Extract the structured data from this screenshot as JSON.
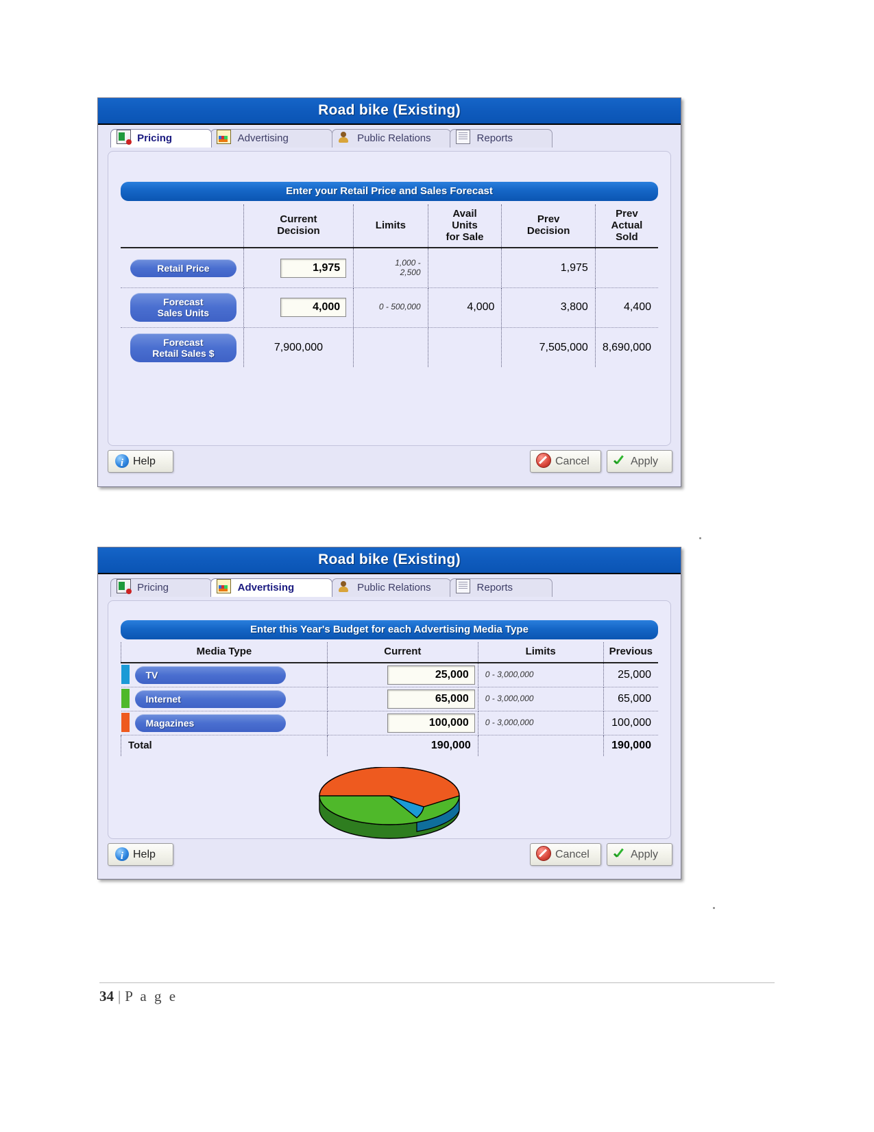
{
  "document": {
    "page_label": "34",
    "page_word": "P a g e",
    "separator": "|"
  },
  "colors": {
    "title_blue": "#0f5bbd",
    "banner_blue": "#1566c6",
    "pill_blue": "#4a6fd0",
    "tv": "#1b9ad6",
    "internet": "#4fb82a",
    "magazines": "#ee5a1f",
    "panel_bg": "#eaeafa"
  },
  "dialogs": [
    {
      "id": "pricing-dialog",
      "title": "Road bike (Existing)",
      "tabs": [
        {
          "label": "Pricing",
          "icon": "pricing-document-icon",
          "active": true
        },
        {
          "label": "Advertising",
          "icon": "advertising-chart-icon",
          "active": false
        },
        {
          "label": "Public Relations",
          "icon": "public-relations-person-icon",
          "active": false
        },
        {
          "label": "Reports",
          "icon": "reports-page-icon",
          "active": false
        }
      ],
      "section_title": "Enter your Retail Price and Sales Forecast",
      "columns": [
        "",
        "Current Decision",
        "Limits",
        "Avail Units for Sale",
        "Prev Decision",
        "Prev Actual Sold"
      ],
      "rows": [
        {
          "label": "Retail Price",
          "current": "1,975",
          "editable": true,
          "limits": "1,000 - 2,500",
          "avail": "",
          "prev_decision": "1,975",
          "prev_actual": ""
        },
        {
          "label": "Forecast Sales Units",
          "current": "4,000",
          "editable": true,
          "limits": "0 - 500,000",
          "avail": "4,000",
          "prev_decision": "3,800",
          "prev_actual": "4,400"
        },
        {
          "label": "Forecast Retail Sales $",
          "current": "7,900,000",
          "editable": false,
          "limits": "",
          "avail": "",
          "prev_decision": "7,505,000",
          "prev_actual": "8,690,000"
        }
      ],
      "buttons": {
        "help": "Help",
        "cancel": "Cancel",
        "apply": "Apply"
      }
    },
    {
      "id": "advertising-dialog",
      "title": "Road bike (Existing)",
      "tabs": [
        {
          "label": "Pricing",
          "icon": "pricing-document-icon",
          "active": false
        },
        {
          "label": "Advertising",
          "icon": "advertising-chart-icon",
          "active": true
        },
        {
          "label": "Public Relations",
          "icon": "public-relations-person-icon",
          "active": false
        },
        {
          "label": "Reports",
          "icon": "reports-page-icon",
          "active": false
        }
      ],
      "section_title": "Enter this Year's Budget for each Advertising Media Type",
      "columns": [
        "Media Type",
        "Current",
        "Limits",
        "Previous"
      ],
      "rows": [
        {
          "label": "TV",
          "swatch": "#1b9ad6",
          "current": "25,000",
          "limits": "0 - 3,000,000",
          "previous": "25,000"
        },
        {
          "label": "Internet",
          "swatch": "#4fb82a",
          "current": "65,000",
          "limits": "0 - 3,000,000",
          "previous": "65,000"
        },
        {
          "label": "Magazines",
          "swatch": "#ee5a1f",
          "current": "100,000",
          "limits": "0 - 3,000,000",
          "previous": "100,000"
        }
      ],
      "total": {
        "label": "Total",
        "current": "190,000",
        "limits": "",
        "previous": "190,000"
      },
      "buttons": {
        "help": "Help",
        "cancel": "Cancel",
        "apply": "Apply"
      }
    }
  ],
  "chart_data": {
    "type": "pie",
    "title": "",
    "labels": [
      "TV",
      "Internet",
      "Magazines"
    ],
    "values": [
      25000,
      65000,
      100000
    ],
    "percentages": [
      13.2,
      34.2,
      52.6
    ],
    "colors": [
      "#1b9ad6",
      "#4fb82a",
      "#ee5a1f"
    ],
    "total": 190000,
    "three_d": true,
    "legend": "none"
  }
}
